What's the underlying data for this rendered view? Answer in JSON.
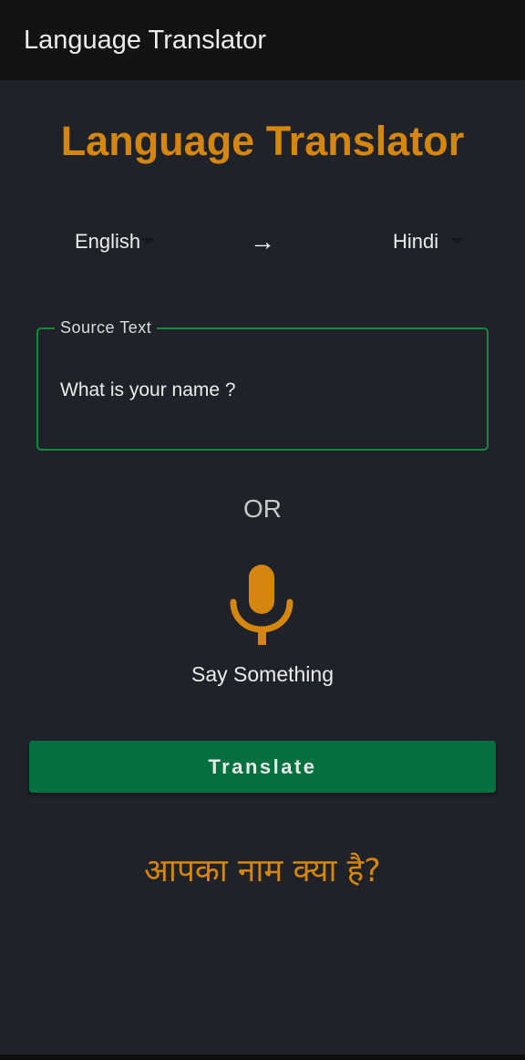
{
  "app": {
    "title": "Language Translator"
  },
  "main": {
    "heading": "Language Translator",
    "languages": {
      "from": "English",
      "to": "Hindi",
      "arrow": "→"
    },
    "source": {
      "label": "Source Text",
      "value": "What is your name ?"
    },
    "or_label": "OR",
    "voice": {
      "icon": "microphone-icon",
      "label": "Say Something"
    },
    "translate_label": "Translate",
    "result": "आपका नाम क्या है?"
  },
  "colors": {
    "accent": "#d4860e",
    "button": "#067041",
    "field_border": "#138a3e",
    "background": "#202229",
    "appbar": "#131313"
  }
}
